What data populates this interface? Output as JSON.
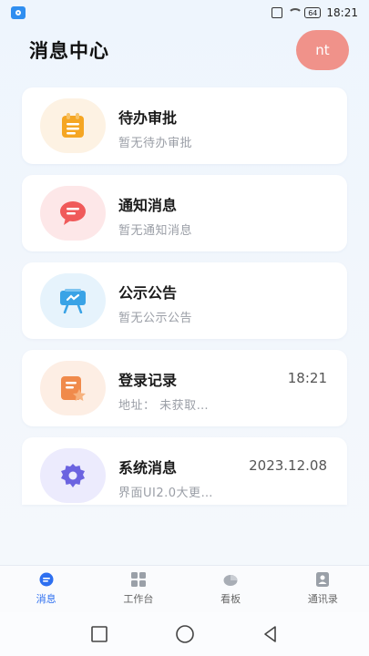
{
  "status_bar": {
    "battery": "64",
    "time": "18:21"
  },
  "header": {
    "title": "消息中心",
    "avatar_text": "nt"
  },
  "messages": [
    {
      "icon": "clipboard-icon",
      "icon_bg": "#fdf2e3",
      "accent": "#f5a623",
      "title": "待办审批",
      "subtitle": "暂无待办审批",
      "time": ""
    },
    {
      "icon": "chat-bubble-icon",
      "icon_bg": "#fde7e8",
      "accent": "#f05a5a",
      "title": "通知消息",
      "subtitle": "暂无通知消息",
      "time": ""
    },
    {
      "icon": "presentation-board-icon",
      "icon_bg": "#e6f3fc",
      "accent": "#3aa3e6",
      "title": "公示公告",
      "subtitle": "暂无公示公告",
      "time": ""
    },
    {
      "icon": "document-star-icon",
      "icon_bg": "#fdeee4",
      "accent": "#f08a4b",
      "title": "登录记录",
      "subtitle": "地址：  未获取…",
      "time": "18:21"
    },
    {
      "icon": "gear-icon",
      "icon_bg": "#ecebfd",
      "accent": "#6b63e0",
      "title": "系统消息",
      "subtitle": "界面UI2.0大更…",
      "time": "2023.12.08"
    }
  ],
  "bottom_nav": [
    {
      "icon": "message-icon",
      "label": "消息",
      "active": true
    },
    {
      "icon": "workbench-grid-icon",
      "label": "工作台",
      "active": false
    },
    {
      "icon": "dashboard-icon",
      "label": "看板",
      "active": false
    },
    {
      "icon": "contacts-icon",
      "label": "通讯录",
      "active": false
    }
  ],
  "colors": {
    "accent": "#2d6ff0",
    "avatar_bg": "#f0928a"
  }
}
